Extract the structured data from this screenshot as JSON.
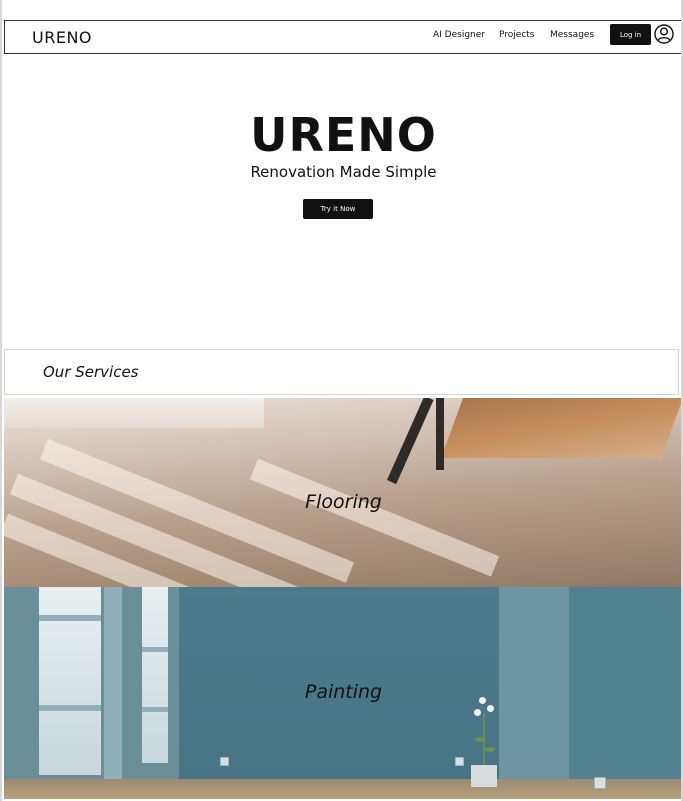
{
  "nav": {
    "logo": "URENO",
    "links": [
      "AI Designer",
      "Projects",
      "Messages"
    ],
    "login_label": "Log in",
    "user_icon": "user-circle-icon"
  },
  "hero": {
    "title": "URENO",
    "subtitle": "Renovation Made Simple",
    "cta_label": "Try it Now"
  },
  "services": {
    "heading": "Our Services",
    "items": [
      {
        "label": "Flooring"
      },
      {
        "label": "Painting"
      }
    ]
  }
}
